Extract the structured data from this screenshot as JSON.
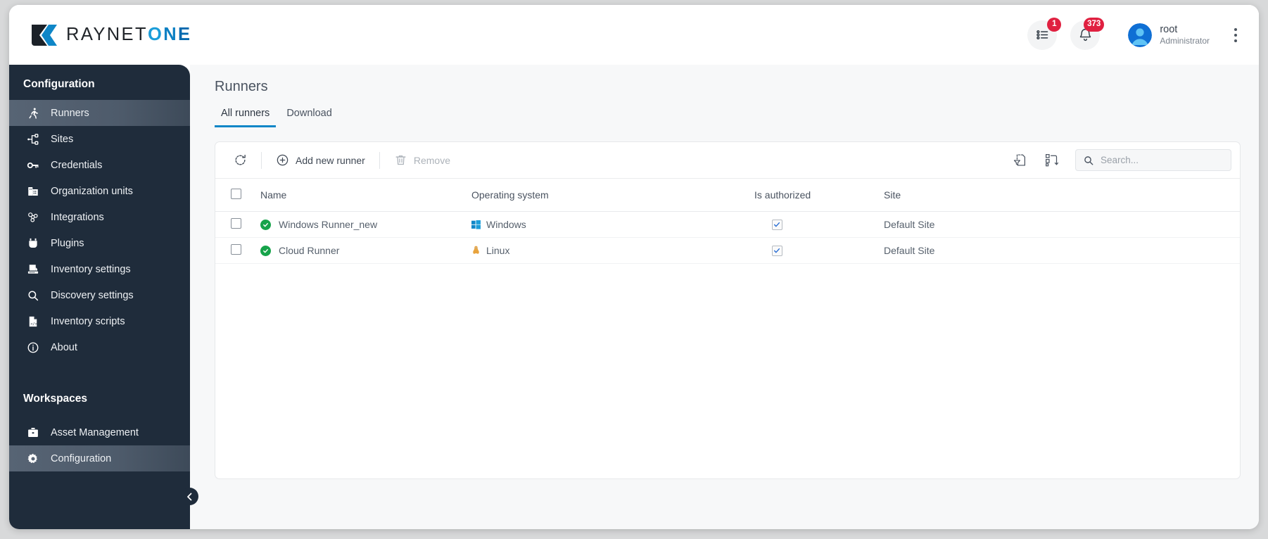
{
  "brand": {
    "name_primary": "RAYNET",
    "name_secondary": "ONE",
    "accent_blue": "#0f86c7",
    "logo_dark": "#22262b"
  },
  "header": {
    "tasks_badge": "1",
    "notifications_badge": "373",
    "user_name": "root",
    "user_role": "Administrator"
  },
  "sidebar": {
    "section_title": "Configuration",
    "items": [
      {
        "label": "Runners",
        "icon": "runner-icon",
        "active": true
      },
      {
        "label": "Sites",
        "icon": "sites-icon",
        "active": false
      },
      {
        "label": "Credentials",
        "icon": "key-icon",
        "active": false
      },
      {
        "label": "Organization units",
        "icon": "building-icon",
        "active": false
      },
      {
        "label": "Integrations",
        "icon": "integrations-icon",
        "active": false
      },
      {
        "label": "Plugins",
        "icon": "plugin-icon",
        "active": false
      },
      {
        "label": "Inventory settings",
        "icon": "inventory-settings-icon",
        "active": false
      },
      {
        "label": "Discovery settings",
        "icon": "magnifier-icon",
        "active": false
      },
      {
        "label": "Inventory scripts",
        "icon": "script-file-icon",
        "active": false
      },
      {
        "label": "About",
        "icon": "info-icon",
        "active": false
      }
    ],
    "workspaces_title": "Workspaces",
    "workspaces": [
      {
        "label": "Asset Management",
        "icon": "briefcase-icon",
        "active": false
      },
      {
        "label": "Configuration",
        "icon": "gear-icon",
        "active": true
      }
    ]
  },
  "main": {
    "page_title": "Runners",
    "tabs": [
      {
        "label": "All runners",
        "active": true
      },
      {
        "label": "Download",
        "active": false
      }
    ],
    "toolbar": {
      "refresh_label": "Refresh",
      "add_label": "Add new runner",
      "remove_label": "Remove",
      "filter_label": "Filter",
      "columns_label": "Reset layout",
      "search_placeholder": "Search...",
      "search_value": ""
    },
    "table": {
      "columns": [
        "Name",
        "Operating system",
        "Is authorized",
        "Site"
      ],
      "rows": [
        {
          "name": "Windows Runner_new",
          "os": "Windows",
          "os_icon": "windows-icon",
          "authorized": true,
          "site": "Default Site",
          "status": "online"
        },
        {
          "name": "Cloud Runner",
          "os": "Linux",
          "os_icon": "linux-icon",
          "authorized": true,
          "site": "Default Site",
          "status": "online"
        }
      ]
    }
  }
}
